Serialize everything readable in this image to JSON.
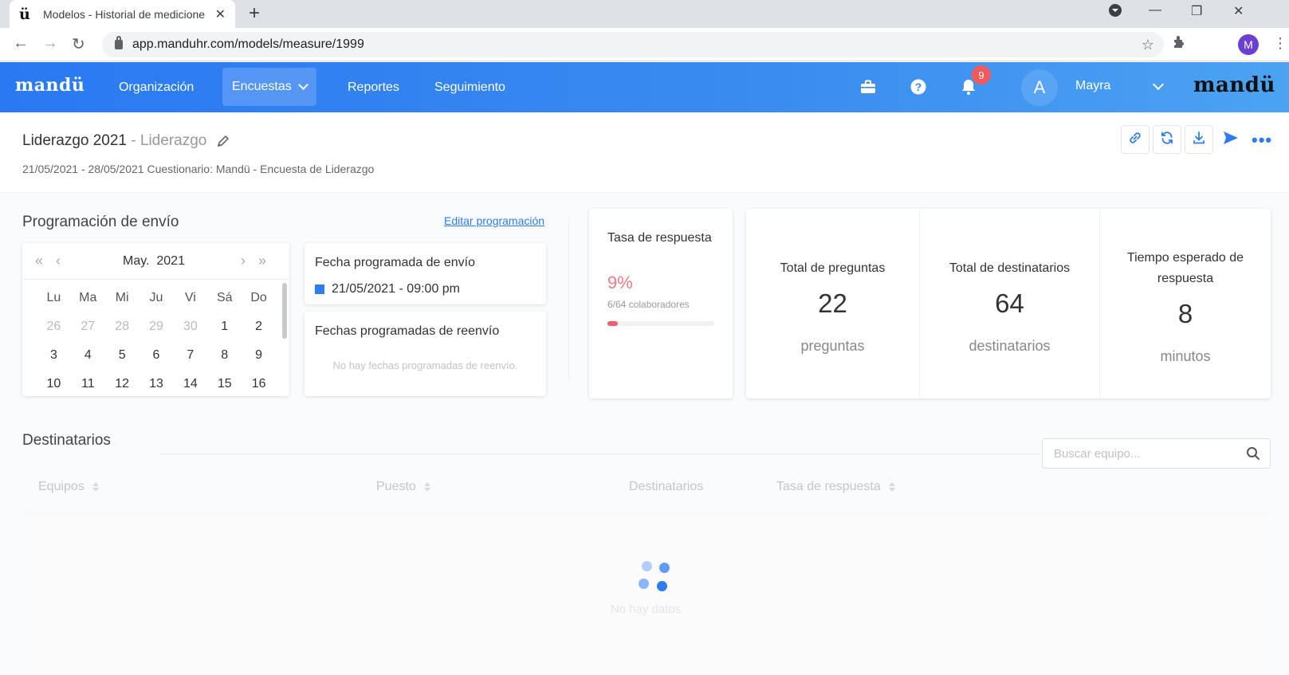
{
  "browser": {
    "tab_title": "Modelos - Historial de medicione",
    "favicon_text": "ü",
    "url": "app.manduhr.com/models/measure/1999",
    "profile_initial": "M"
  },
  "header": {
    "logo": "mandü",
    "logo_right": "mandü",
    "menu": [
      {
        "label": "Organización"
      },
      {
        "label": "Encuestas"
      },
      {
        "label": "Reportes"
      },
      {
        "label": "Seguimiento"
      }
    ],
    "notifications_count": "9",
    "avatar_initial": "A",
    "user_name": "Mayra",
    "accent_color": "#2979f2"
  },
  "title": {
    "name": "Liderazgo 2021",
    "separator": " - ",
    "category": "Liderazgo",
    "meta": "21/05/2021 - 28/05/2021 Cuestionario: Mandü - Encuesta de Liderazgo"
  },
  "schedule": {
    "section_title": "Programación de envío",
    "edit_link": "Editar programación",
    "calendar": {
      "month": "May.",
      "year": "2021",
      "weekdays": [
        "Lu",
        "Ma",
        "Mi",
        "Ju",
        "Vi",
        "Sá",
        "Do"
      ],
      "weeks": [
        [
          "26",
          "27",
          "28",
          "29",
          "30",
          "1",
          "2"
        ],
        [
          "3",
          "4",
          "5",
          "6",
          "7",
          "8",
          "9"
        ],
        [
          "10",
          "11",
          "12",
          "13",
          "14",
          "15",
          "16"
        ]
      ]
    },
    "send_title": "Fecha programada de envío",
    "send_date": "21/05/2021 - 09:00 pm",
    "resend_title": "Fechas programadas de reenvío",
    "resend_empty": "No hay fechas programadas de reenvío."
  },
  "response_rate": {
    "title": "Tasa de respuesta",
    "percent": "9%",
    "detail": "6/64 colaboradores",
    "fraction": 0.094,
    "color": "#f05f6f"
  },
  "stats": [
    {
      "label": "Total de preguntas",
      "value": "22",
      "unit": "preguntas"
    },
    {
      "label": "Total de destinatarios",
      "value": "64",
      "unit": "destinatarios"
    },
    {
      "label": "Tiempo esperado de respuesta",
      "value": "8",
      "unit": "minutos"
    }
  ],
  "recipients": {
    "section_title": "Destinatarios",
    "search_placeholder": "Buscar equipo...",
    "columns": [
      "Equipos",
      "Puesto",
      "Destinatarios",
      "Tasa de respuesta"
    ],
    "empty_text": "No hay datos"
  }
}
